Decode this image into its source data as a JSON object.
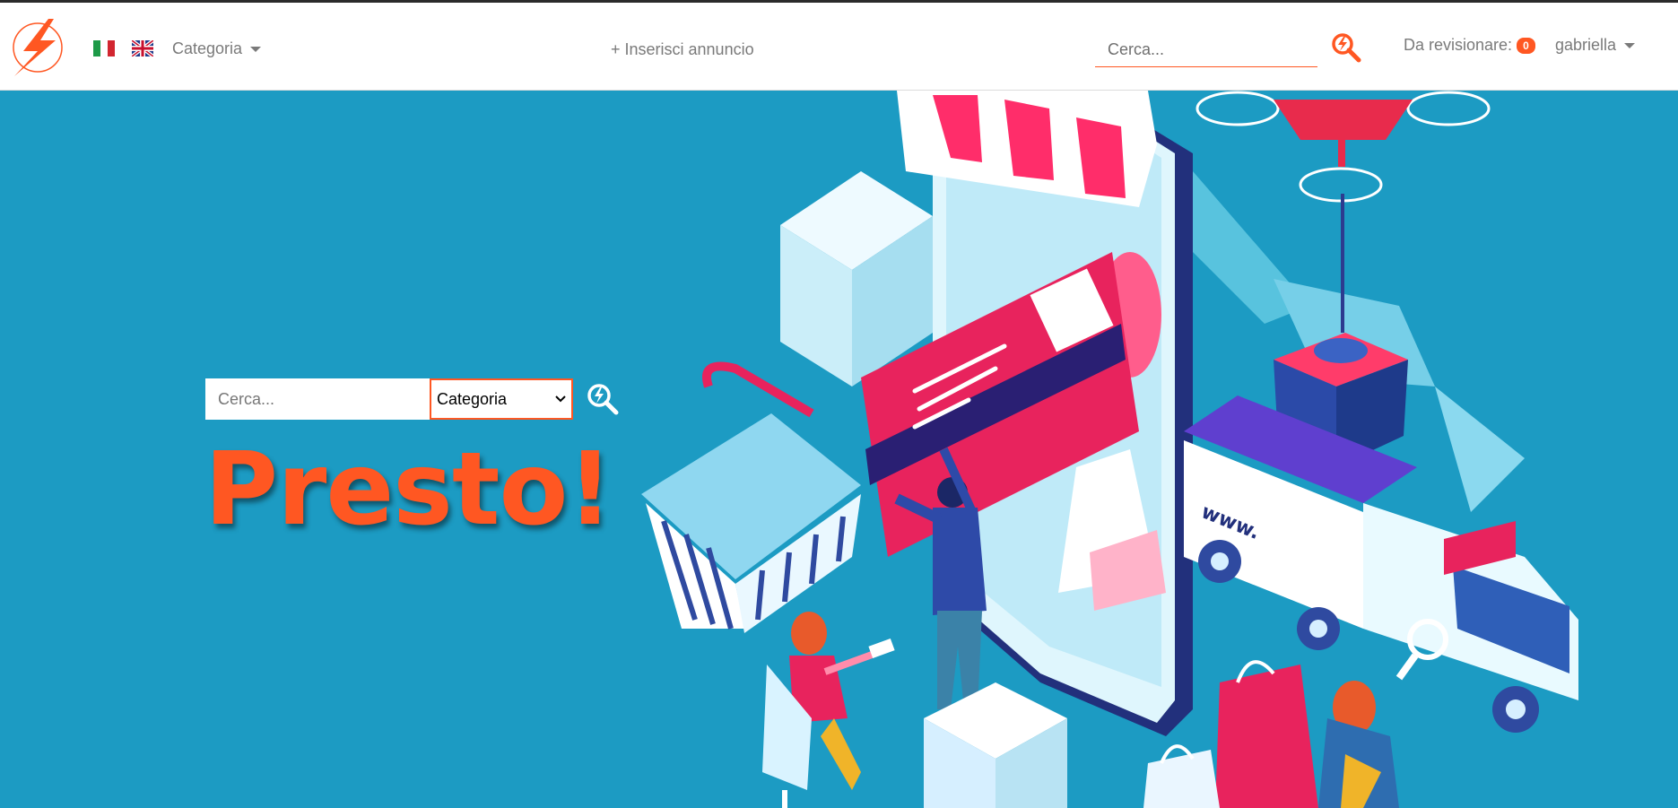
{
  "colors": {
    "accent": "#ff5722",
    "hero_bg": "#1c9bc3",
    "nav_text": "#7a7a7a"
  },
  "navbar": {
    "logo": "lightning-bolt-logo",
    "flags": [
      "italy-flag-icon",
      "uk-flag-icon"
    ],
    "category_label": "Categoria",
    "insert_label": "+ Inserisci annuncio",
    "search_placeholder": "Cerca...",
    "revision_label": "Da revisionare:",
    "revision_count": "0",
    "user_name": "gabriella"
  },
  "hero": {
    "search_placeholder": "Cerca...",
    "category_selected": "Categoria",
    "brand_title": "Presto!",
    "illustration": "isometric-ecommerce-illustration"
  }
}
